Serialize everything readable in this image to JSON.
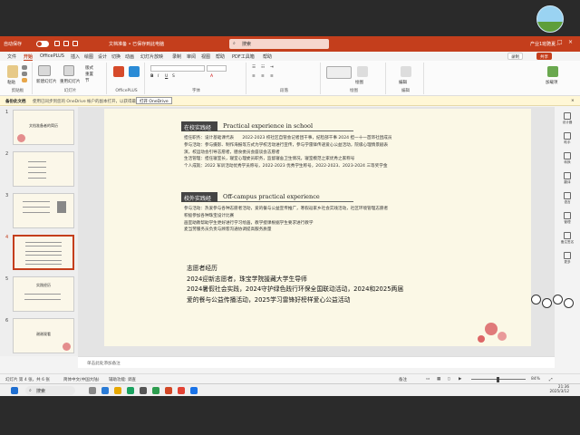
{
  "titlebar": {
    "autosave": "自动保存",
    "doc_title": "文档准备 • 已保存到此电脑",
    "search_placeholder": "搜索",
    "user": "产业1班驰夏..."
  },
  "tabs": [
    "文件",
    "开始",
    "OfficePLUS",
    "插入",
    "绘图",
    "设计",
    "切换",
    "动画",
    "幻灯片放映",
    "录制",
    "审阅",
    "视图",
    "帮助",
    "PDF工具箱",
    "帮助"
  ],
  "tab_buttons": {
    "record": "录制",
    "share": "共享"
  },
  "ribbon": {
    "groups": [
      "剪贴板",
      "幻灯片",
      "OfficePLUS",
      "字体",
      "段落",
      "绘图",
      "编辑"
    ],
    "labels": {
      "paste": "粘贴",
      "new_slide": "新建幻灯片",
      "reuse": "重用幻灯片",
      "layout": "版式",
      "reset": "重置",
      "section": "节",
      "drawing": "绘图",
      "editing": "编辑",
      "addin": "加载项"
    }
  },
  "notify": {
    "title": "备份此文档",
    "message": "使用已同步到您的 OneDrive 帐户的副本打开，以获得最佳体验。",
    "open_button": "打开 OneDrive"
  },
  "thumbnails": [
    {
      "no": "1",
      "caption": "文档准备者的简历"
    },
    {
      "no": "2",
      "caption": ""
    },
    {
      "no": "3",
      "caption": ""
    },
    {
      "no": "4",
      "caption": ""
    },
    {
      "no": "5",
      "caption": "实践经历"
    },
    {
      "no": "6",
      "caption": "谢谢观看"
    }
  ],
  "slide": {
    "section1": {
      "cn": "在校实践经历",
      "en": "Practical experience in school",
      "lines": [
        "担任职务：设计基础课代表　　2022-2023 校社区自管会记者团干事，纪检部干事 2024 担一十一首饰社团成员",
        "参与活动：参与摄影、制作海报等方式为学校活动进行宣传，参与学雷锋传递爱心公益活动，院级心理情景剧表",
        "演，校运动会引导志愿者，膳食委员会座谈会志愿者",
        "生活管理：担任寝室长，寝室心理委员职务，监督寝舍卫生情况，寝室模范之家优秀之家称号",
        "个人成就：2022 军训活动优秀学员称号，2022-2023 优秀学生称号，2022-2023、2023-2024 三等奖学金"
      ]
    },
    "section2": {
      "cn": "校外实践经历",
      "en": "Off-campus practical experience",
      "lines": [
        "参与活动：热爱参与各种志愿者活动，爱的餐与公益宣传推广，寒假返家乡社会实践活动，社区环境管理志愿者",
        "积极参加各种珠宝设计比赛",
        "画室助教帮助学生更好进行学习绘画，教学授课根据学生要求进行教学",
        "麦当劳服务员负责与顾客沟通协调提高服务质量"
      ]
    },
    "volunteer": {
      "title": "志愿者经历",
      "lines": [
        "2024迎新志愿者，珠宝学院援藏大学生导师",
        "2024暑假社会实践，2024守护绿色践行环保全国联动活动，2024和2025两届",
        "爱的餐与公益传播活动，2025学习雷锋好榜样爱心公益活动"
      ]
    }
  },
  "right_panel": [
    "设计器",
    "助手",
    "转换",
    "翻译",
    "语言",
    "管理",
    "备注签名",
    "更多"
  ],
  "notes_placeholder": "单击此处添加备注",
  "status": {
    "slide_info": "幻灯片 第 4 张，共 6 张",
    "language": "简体中文(中国大陆)",
    "accessibility": "辅助功能: 调查",
    "notes": "备注",
    "zoom": "84%"
  },
  "taskbar": {
    "search": "搜索",
    "time": "21:36",
    "date": "2025/3/12"
  },
  "colors": {
    "accent": "#c43e1c",
    "slide_bg": "#fbf8e6",
    "header_box": "#444444"
  }
}
